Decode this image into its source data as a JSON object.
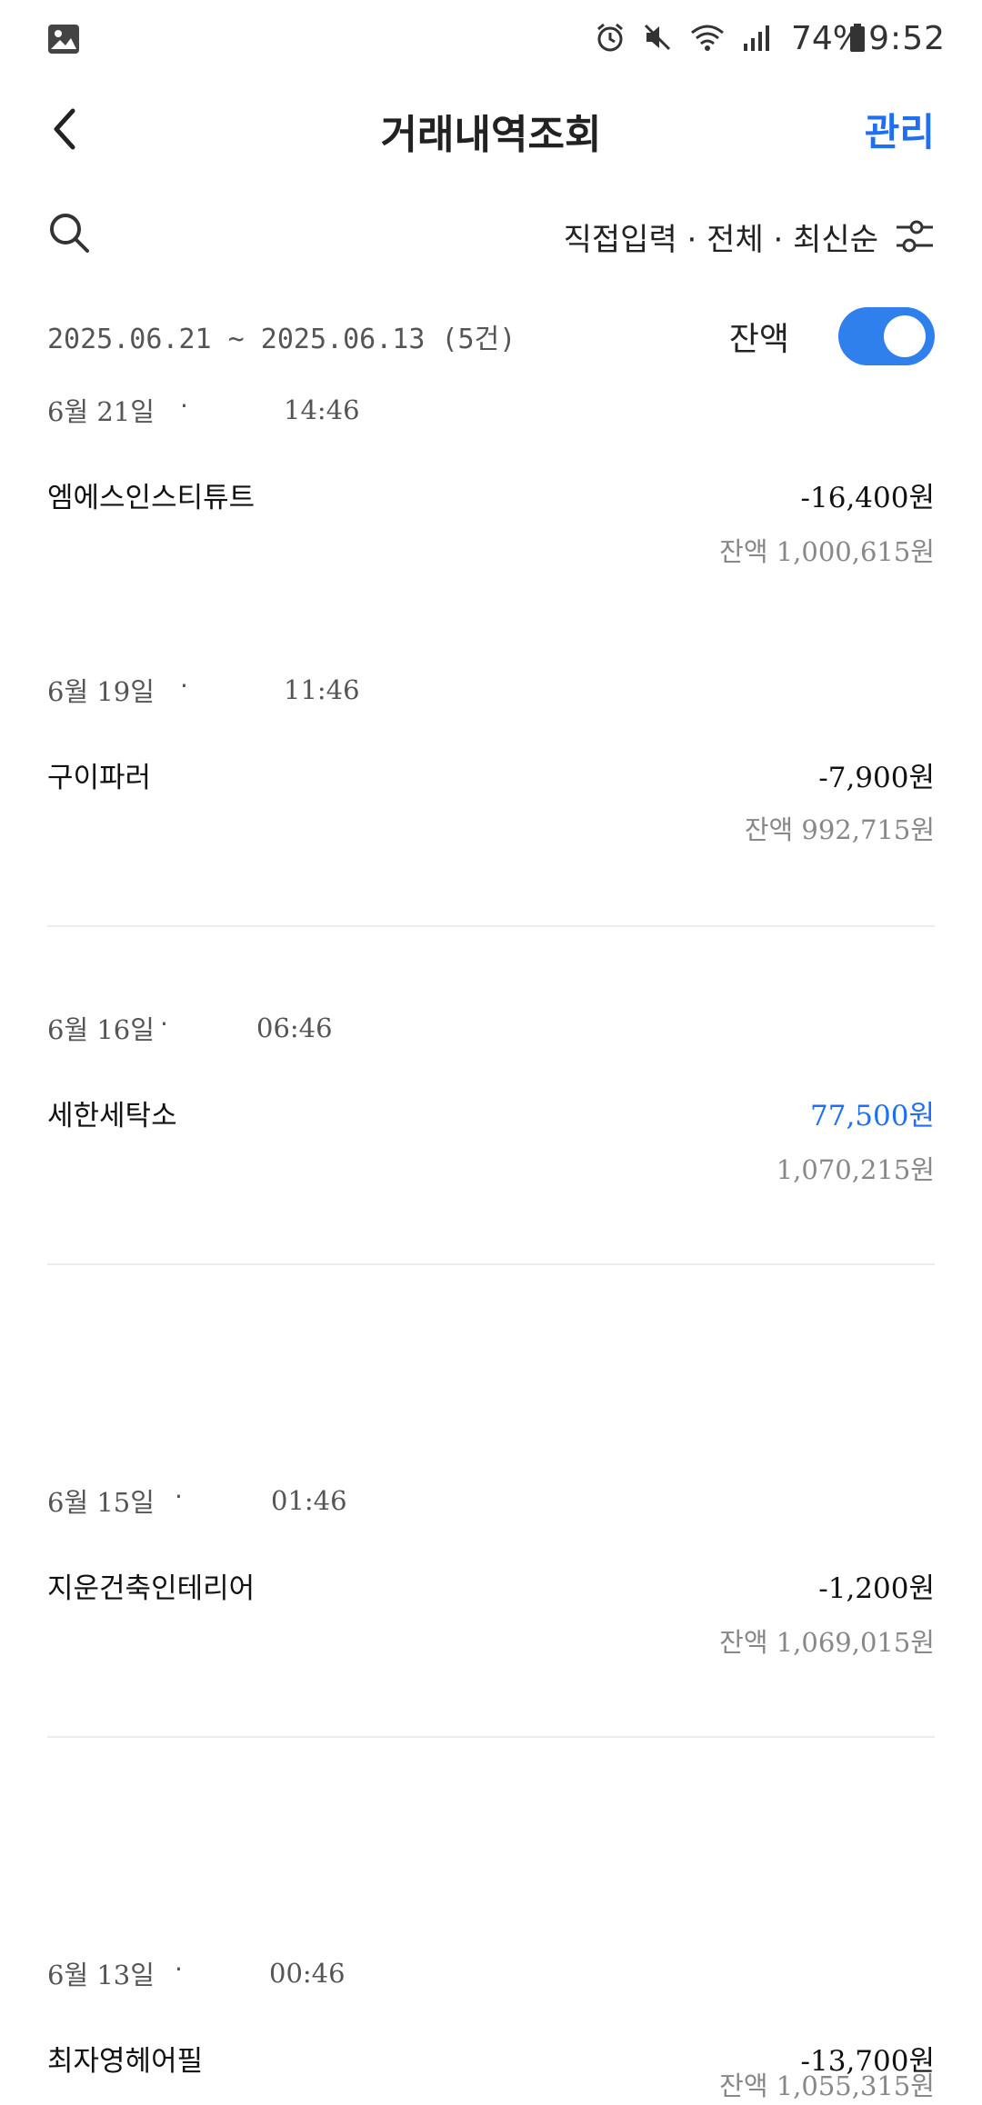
{
  "status_bar": {
    "time": "9:52",
    "battery": "74%",
    "icons": [
      "gallery-icon",
      "alarm-icon",
      "mute-icon",
      "wifi-icon",
      "signal-icon",
      "battery-icon"
    ]
  },
  "header": {
    "title": "거래내역조회",
    "manage_label": "관리"
  },
  "filter": {
    "summary": "직접입력 · 전체 · 최신순"
  },
  "range": {
    "text": "2025.06.21 ~ 2025.06.13 (5건)",
    "balance_label": "잔액",
    "balance_toggle_on": true
  },
  "colors": {
    "accent": "#1f6ff2",
    "toggle": "#2f80ed"
  },
  "transactions": [
    {
      "date": "6월 21일",
      "dot": "·",
      "time": "14:46",
      "merchant": "엠에스인스티튜트",
      "amount": "-16,400원",
      "balance": "잔액 1,000,615원"
    },
    {
      "date": "6월 19일",
      "dot": "·",
      "time": "11:46",
      "merchant": "구이파러",
      "amount": "-7,900원",
      "balance": "잔액 992,715원"
    },
    {
      "date": "6월 16일",
      "dot": "·",
      "time": "06:46",
      "merchant": "세한세탁소",
      "amount": "77,500원",
      "balance": "1,070,215원"
    },
    {
      "date": "6월 15일",
      "dot": "·",
      "time": "01:46",
      "merchant": "지운건축인테리어",
      "amount": "-1,200원",
      "balance": "잔액 1,069,015원"
    },
    {
      "date": "6월 13일",
      "dot": "·",
      "time": "00:46",
      "merchant": "최자영헤어필",
      "amount": "-13,700원",
      "balance": "잔액 1,055,315원"
    }
  ]
}
